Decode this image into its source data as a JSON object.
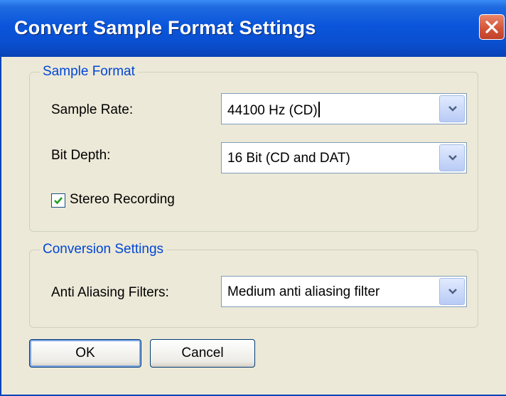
{
  "window": {
    "title": "Convert Sample Format Settings"
  },
  "sample_format": {
    "legend": "Sample Format",
    "sample_rate": {
      "label": "Sample Rate:",
      "value": "44100 Hz (CD)"
    },
    "bit_depth": {
      "label": "Bit Depth:",
      "value": "16 Bit (CD and DAT)"
    },
    "stereo": {
      "label": "Stereo Recording",
      "checked": true
    }
  },
  "conversion": {
    "legend": "Conversion Settings",
    "anti_aliasing": {
      "label": "Anti Aliasing Filters:",
      "value": "Medium anti aliasing filter"
    }
  },
  "buttons": {
    "ok": "OK",
    "cancel": "Cancel"
  }
}
